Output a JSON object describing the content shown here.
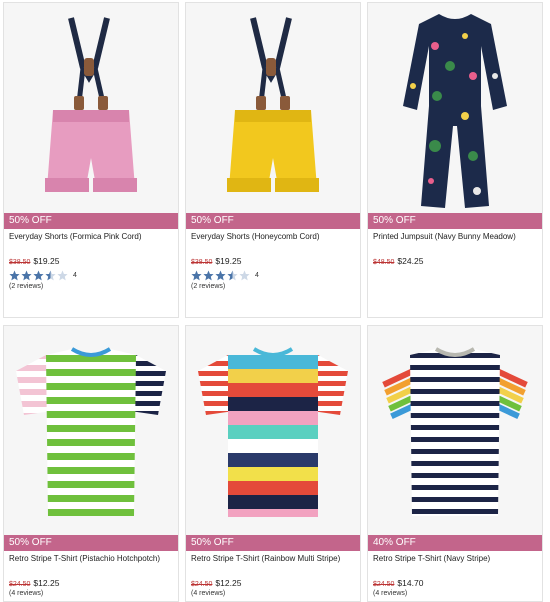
{
  "colors": {
    "badge_bg": "#c3658b",
    "was_price": "#b33333",
    "star_fill": "#4a74a8",
    "star_outline": "#9ab0cc"
  },
  "products": [
    {
      "badge": "50% OFF",
      "title": "Everyday Shorts (Formica Pink Cord)",
      "was": "$38.50",
      "now": "$19.25",
      "rating": 3.5,
      "rating_count": "4",
      "reviews": "(2 reviews)",
      "image": "pink-corduroy-shorts-with-suspenders"
    },
    {
      "badge": "50% OFF",
      "title": "Everyday Shorts (Honeycomb Cord)",
      "was": "$38.50",
      "now": "$19.25",
      "rating": 3.5,
      "rating_count": "4",
      "reviews": "(2 reviews)",
      "image": "yellow-corduroy-shorts-with-suspenders"
    },
    {
      "badge": "50% OFF",
      "title": "Printed Jumpsuit (Navy Bunny Meadow)",
      "was": "$48.50",
      "now": "$24.25",
      "rating": null,
      "rating_count": "",
      "reviews": "",
      "image": "navy-printed-jumpsuit"
    },
    {
      "badge": "50% OFF",
      "title": "Retro Stripe T-Shirt (Pistachio Hotchpotch)",
      "was": "$24.50",
      "now": "$12.25",
      "rating": null,
      "rating_count": "",
      "reviews": "(4 reviews)",
      "image": "green-striped-tshirt"
    },
    {
      "badge": "50% OFF",
      "title": "Retro Stripe T-Shirt (Rainbow Multi Stripe)",
      "was": "$24.50",
      "now": "$12.25",
      "rating": null,
      "rating_count": "",
      "reviews": "(4 reviews)",
      "image": "rainbow-striped-tshirt"
    },
    {
      "badge": "40% OFF",
      "title": "Retro Stripe T-Shirt (Navy Stripe)",
      "was": "$24.50",
      "now": "$14.70",
      "rating": null,
      "rating_count": "",
      "reviews": "(4 reviews)",
      "image": "navy-striped-tshirt"
    }
  ]
}
